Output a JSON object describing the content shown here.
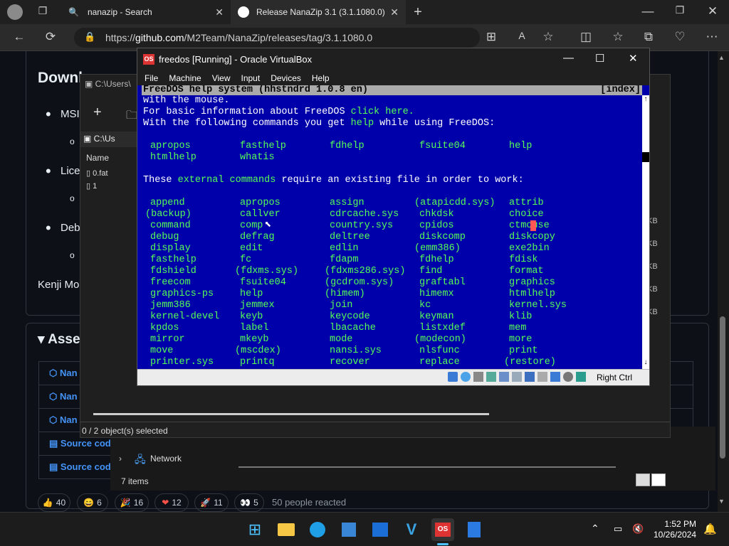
{
  "browser": {
    "tabs": [
      {
        "label": "nanazip - Search"
      },
      {
        "label": "Release NanaZip 3.1 (3.1.1080.0)"
      }
    ],
    "url_prefix": "https://",
    "url_domain": "github.com",
    "url_path": "/M2Team/NanaZip/releases/tag/3.1.1080.0"
  },
  "github": {
    "heading": "Downl",
    "bullets": [
      "MSI",
      "Lice",
      "Deb"
    ],
    "author": "Kenji Mo",
    "assets_heading": "Asset",
    "asset_rows": [
      "Nan",
      "Nan",
      "Nan",
      "Source cod",
      "Source cod"
    ],
    "reactions": [
      {
        "icon": "👍",
        "count": "40"
      },
      {
        "icon": "😄",
        "count": "6"
      },
      {
        "icon": "🎉",
        "count": "16"
      },
      {
        "icon": "❤",
        "count": "12"
      },
      {
        "icon": "🚀",
        "count": "11"
      },
      {
        "icon": "👀",
        "count": "5"
      }
    ],
    "reacted_text": "50 people reacted"
  },
  "explorer": {
    "path1": "C:\\Users\\",
    "path2": "C:\\Us",
    "column_name": "Name",
    "files": [
      "0.fat",
      "1"
    ],
    "status": "0 / 2 object(s) selected",
    "network_label": "Network",
    "items_count": "7 items",
    "kb_label": "KB"
  },
  "vbox": {
    "title": "freedos [Running] - Oracle VirtualBox",
    "menu": [
      "File",
      "Machine",
      "View",
      "Input",
      "Devices",
      "Help"
    ],
    "host_key": "Right Ctrl",
    "dos": {
      "header_left": "FreeDOS help system (hhstndrd 1.0.8 en)",
      "header_right": "[index]",
      "line1": "with the mouse.",
      "line2_pre": "For basic information about FreeDOS ",
      "line2_link": "click here.",
      "line3_pre": "With the following commands you get ",
      "line3_link": "help",
      "line3_post": " while using FreeDOS:",
      "help_cmds": [
        "apropos",
        "fasthelp",
        "fdhelp",
        "fsuite04",
        "help",
        "htmlhelp",
        "whatis"
      ],
      "ext_pre": "These ",
      "ext_link": "external commands",
      "ext_post": " require an existing file in order to work:",
      "commands": [
        "append",
        "apropos",
        "assign",
        "(atapicdd.sys)",
        "attrib",
        "(backup)",
        "callver",
        "cdrcache.sys",
        "chkdsk",
        "choice",
        "command",
        "comp",
        "country.sys",
        "cpidos",
        "ctmouse",
        "debug",
        "defrag",
        "deltree",
        "diskcomp",
        "diskcopy",
        "display",
        "edit",
        "edlin",
        "(emm386)",
        "exe2bin",
        "fasthelp",
        "fc",
        "fdapm",
        "fdhelp",
        "fdisk",
        "fdshield",
        "(fdxms.sys)",
        "(fdxms286.sys)",
        "find",
        "format",
        "freecom",
        "fsuite04",
        "(gcdrom.sys)",
        "graftabl",
        "graphics",
        "graphics-ps",
        "help",
        "(himem)",
        "himemx",
        "htmlhelp",
        "jemm386",
        "jemmex",
        "join",
        "kc",
        "kernel.sys",
        "kernel-devel",
        "keyb",
        "keycode",
        "keyman",
        "klib",
        "kpdos",
        "label",
        "lbacache",
        "listxdef",
        "mem",
        "mirror",
        "mkeyb",
        "mode",
        "(modecon)",
        "more",
        "move",
        "(mscdex)",
        "nansi.sys",
        "nlsfunc",
        "print",
        "printer.sys",
        "printq",
        "recover",
        "replace",
        "(restore)"
      ]
    }
  },
  "taskbar": {
    "time": "1:52 PM",
    "date": "10/26/2024"
  }
}
